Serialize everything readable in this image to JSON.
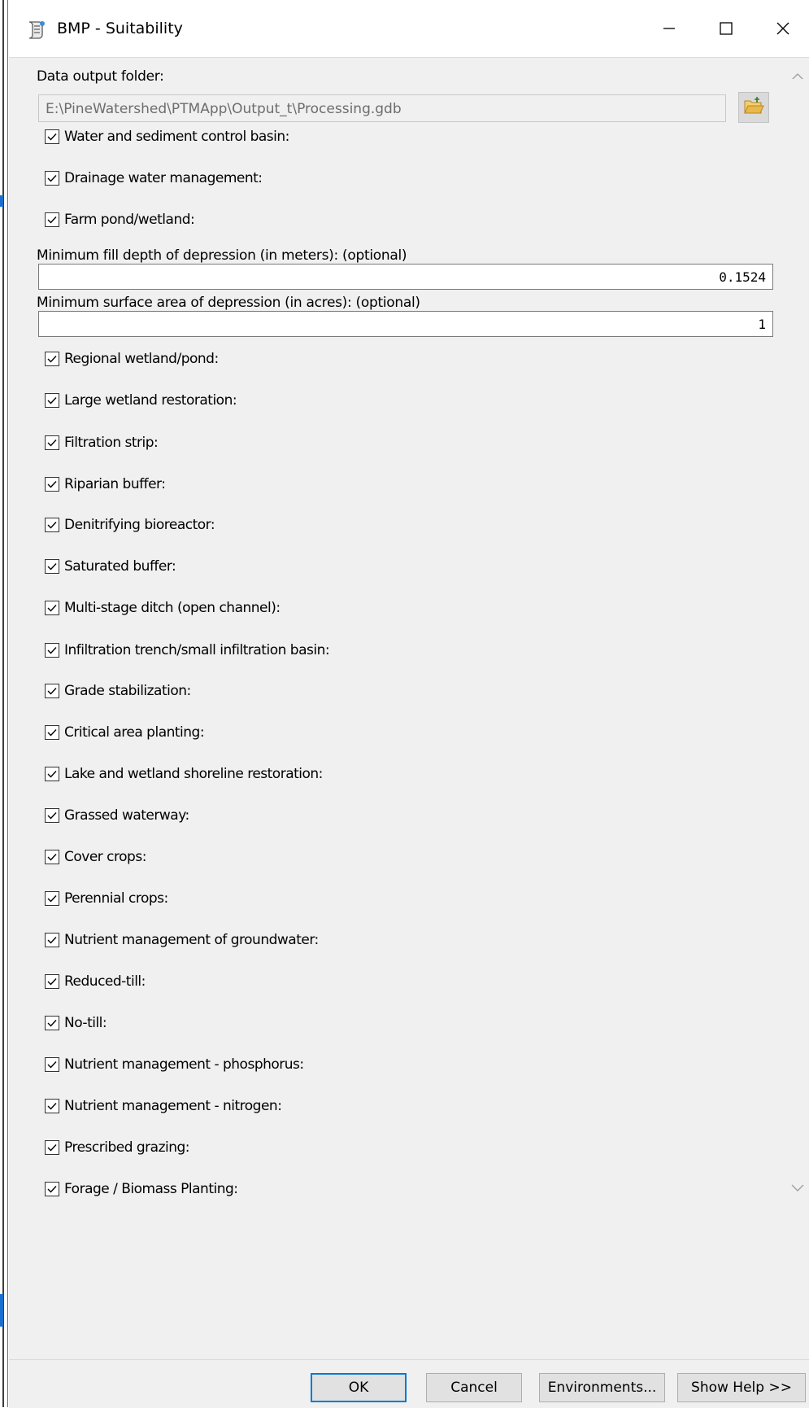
{
  "window": {
    "title": "BMP - Suitability",
    "icon": "script-tool-icon",
    "controls": [
      "minimize-icon",
      "maximize-icon",
      "close-icon"
    ]
  },
  "output": {
    "label": "Data output folder:",
    "path": "E:\\PineWatershed\\PTMApp\\Output_t\\Processing.gdb",
    "browse_icon": "open-folder-icon"
  },
  "checks": {
    "c01": {
      "label": "Water and sediment control basin:",
      "checked": true
    },
    "c02": {
      "label": "Drainage water management:",
      "checked": true
    },
    "c03": {
      "label": "Farm pond/wetland:",
      "checked": true
    },
    "c04": {
      "label": "Regional wetland/pond:",
      "checked": true
    },
    "c05": {
      "label": "Large wetland restoration:",
      "checked": true
    },
    "c06": {
      "label": "Filtration strip:",
      "checked": true
    },
    "c07": {
      "label": "Riparian buffer:",
      "checked": true
    },
    "c08": {
      "label": "Denitrifying bioreactor:",
      "checked": true
    },
    "c09": {
      "label": "Saturated buffer:",
      "checked": true
    },
    "c10": {
      "label": "Multi-stage ditch (open channel):",
      "checked": true
    },
    "c11": {
      "label": "Infiltration trench/small infiltration basin:",
      "checked": true
    },
    "c12": {
      "label": "Grade stabilization:",
      "checked": true
    },
    "c13": {
      "label": "Critical area planting:",
      "checked": true
    },
    "c14": {
      "label": "Lake and wetland shoreline restoration:",
      "checked": true
    },
    "c15": {
      "label": "Grassed waterway:",
      "checked": true
    },
    "c16": {
      "label": "Cover crops:",
      "checked": true
    },
    "c17": {
      "label": "Perennial crops:",
      "checked": true
    },
    "c18": {
      "label": "Nutrient management of groundwater:",
      "checked": true
    },
    "c19": {
      "label": "Reduced-till:",
      "checked": true
    },
    "c20": {
      "label": "No-till:",
      "checked": true
    },
    "c21": {
      "label": "Nutrient management - phosphorus:",
      "checked": true
    },
    "c22": {
      "label": "Nutrient management - nitrogen:",
      "checked": true
    },
    "c23": {
      "label": "Prescribed grazing:",
      "checked": true
    },
    "c24": {
      "label": "Forage / Biomass Planting:",
      "checked": true
    }
  },
  "depth": {
    "label": "Minimum fill depth of depression (in meters): (optional)",
    "value": "0.1524"
  },
  "area": {
    "label": "Minimum surface area of depression (in acres): (optional)",
    "value": "1"
  },
  "buttons": {
    "ok": "OK",
    "cancel": "Cancel",
    "environments": "Environments...",
    "help": "Show Help >>"
  },
  "colors": {
    "client_bg": "#f0f0f0",
    "default_button_border": "#0078d7",
    "folder_icon": "#e8b94a"
  }
}
